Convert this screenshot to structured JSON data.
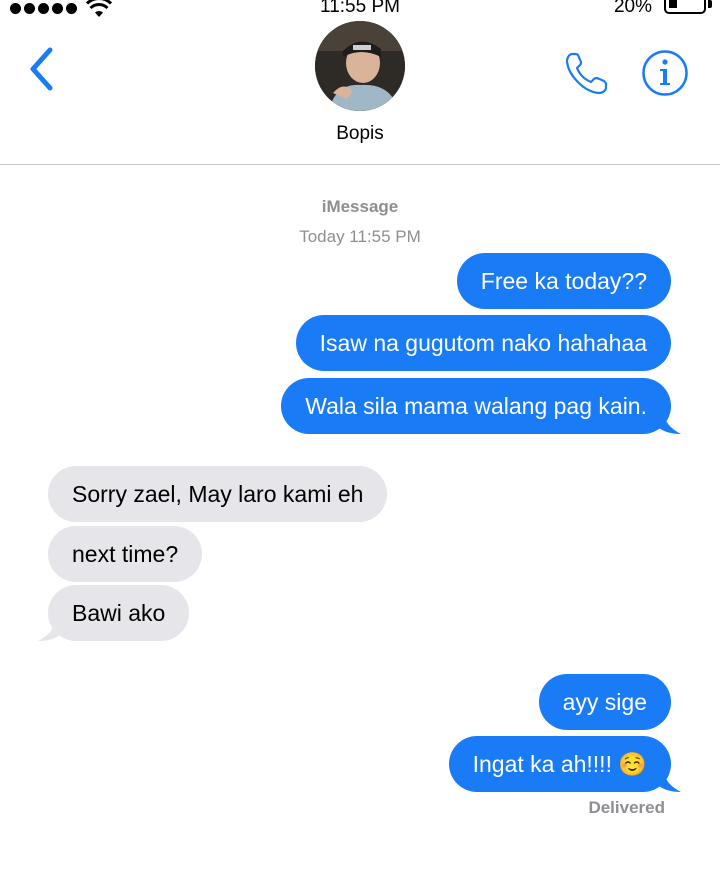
{
  "status_bar": {
    "time": "11:55 PM",
    "battery_percent": "20%",
    "signal_icon": "signal-dots-icon",
    "wifi_icon": "wifi-icon",
    "battery_icon": "battery-icon"
  },
  "header": {
    "contact_name": "Bopis",
    "back_icon": "chevron-left-icon",
    "call_icon": "phone-icon",
    "info_icon": "info-icon",
    "accent_color": "#1a7bf7"
  },
  "conversation": {
    "service": "iMessage",
    "timestamp": "Today 11:55 PM",
    "messages": [
      {
        "from": "me",
        "text": "Free ka today??"
      },
      {
        "from": "me",
        "text": "Isaw na gugutom nako hahahaa"
      },
      {
        "from": "me",
        "text": "Wala sila mama walang pag kain."
      },
      {
        "from": "them",
        "text": "Sorry zael, May laro kami eh"
      },
      {
        "from": "them",
        "text": "next time?"
      },
      {
        "from": "them",
        "text": "Bawi ako"
      },
      {
        "from": "me",
        "text": "ayy sige"
      },
      {
        "from": "me",
        "text": "Ingat ka ah!!!! ☺️"
      }
    ],
    "receipt": "Delivered",
    "sent_color": "#1a7bf7",
    "received_color": "#e5e5ea"
  }
}
